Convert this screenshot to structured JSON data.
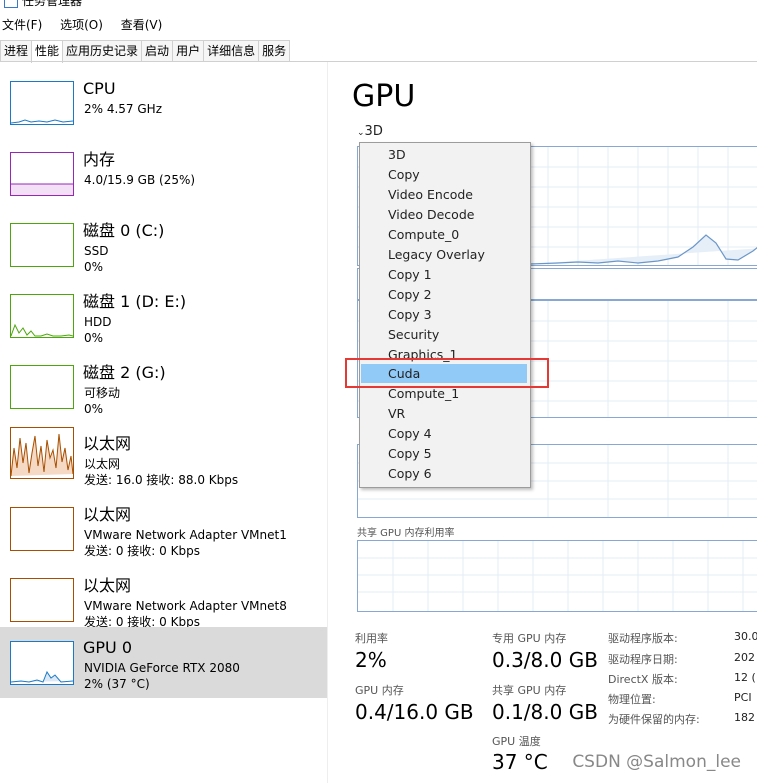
{
  "window": {
    "title": "任务管理器"
  },
  "menu_bar": [
    "文件(F)",
    "选项(O)",
    "查看(V)"
  ],
  "tabs": [
    "进程",
    "性能",
    "应用历史记录",
    "启动",
    "用户",
    "详细信息",
    "服务"
  ],
  "sidebar": {
    "items": [
      {
        "name": "CPU",
        "line2": "2% 4.57 GHz",
        "line3": "",
        "color": "#1b7ac8"
      },
      {
        "name": "内存",
        "line2": "4.0/15.9 GB (25%)",
        "line3": "",
        "color": "#9528b4"
      },
      {
        "name": "磁盘 0 (C:)",
        "line2": "SSD",
        "line3": "0%",
        "color": "#4da60c"
      },
      {
        "name": "磁盘 1 (D: E:)",
        "line2": "HDD",
        "line3": "0%",
        "color": "#4da60c"
      },
      {
        "name": "磁盘 2 (G:)",
        "line2": "可移动",
        "line3": "0%",
        "color": "#4da60c"
      },
      {
        "name": "以太网",
        "line2": "以太网",
        "line3": "发送: 16.0 接收: 88.0 Kbps",
        "color": "#a74f01"
      },
      {
        "name": "以太网",
        "line2": "VMware Network Adapter VMnet1",
        "line3": "发送: 0 接收: 0 Kbps",
        "color": "#a74f01"
      },
      {
        "name": "以太网",
        "line2": "VMware Network Adapter VMnet8",
        "line3": "发送: 0 接收: 0 Kbps",
        "color": "#a74f01"
      },
      {
        "name": "GPU 0",
        "line2": "NVIDIA GeForce RTX 2080",
        "line3": "2% (37 °C)",
        "color": "#1b7ac8"
      }
    ]
  },
  "main": {
    "title": "GPU",
    "engine_selector": "3D",
    "shared_memory_caption": "共享 GPU 内存利用率"
  },
  "engine_menu": {
    "items": [
      "3D",
      "Copy",
      "Video Encode",
      "Video Decode",
      "Compute_0",
      "Legacy Overlay",
      "Copy 1",
      "Copy 2",
      "Copy 3",
      "Security",
      "Graphics_1",
      "Cuda",
      "Compute_1",
      "VR",
      "Copy 4",
      "Copy 5",
      "Copy 6"
    ],
    "highlighted": "Cuda"
  },
  "stats": {
    "utilization": {
      "label": "利用率",
      "value": "2%"
    },
    "dedicated_memory": {
      "label": "专用 GPU 内存",
      "value": "0.3/8.0 GB"
    },
    "gpu_memory": {
      "label": "GPU 内存",
      "value": "0.4/16.0 GB"
    },
    "shared_memory": {
      "label": "共享 GPU 内存",
      "value": "0.1/8.0 GB"
    },
    "temperature": {
      "label": "GPU 温度",
      "value": "37 °C"
    }
  },
  "driver_info": [
    {
      "label": "驱动程序版本:",
      "value": "30.0"
    },
    {
      "label": "驱动程序日期:",
      "value": "202"
    },
    {
      "label": "DirectX 版本:",
      "value": "12 ("
    },
    {
      "label": "物理位置:",
      "value": "PCI"
    },
    {
      "label": "为硬件保留的内存:",
      "value": "182"
    }
  ],
  "watermark": "CSDN @Salmon_lee"
}
